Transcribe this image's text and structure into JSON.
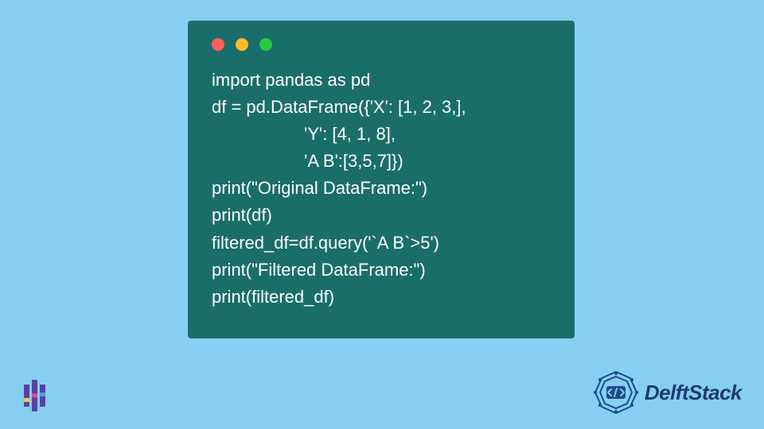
{
  "window": {
    "controls": [
      "close",
      "minimize",
      "maximize"
    ]
  },
  "code": {
    "lines": [
      "import pandas as pd",
      "df = pd.DataFrame({'X': [1, 2, 3,],",
      "                   'Y': [4, 1, 8],",
      "                   'A B':[3,5,7]})",
      "print(\"Original DataFrame:\")",
      "print(df)",
      "filtered_df=df.query('`A B`>5')",
      "print(\"Filtered DataFrame:\")",
      "print(filtered_df)"
    ]
  },
  "branding": {
    "left_logo_alt": "logo-bars",
    "right_logo_alt": "delftstack-badge",
    "brand_name": "DelftStack"
  }
}
